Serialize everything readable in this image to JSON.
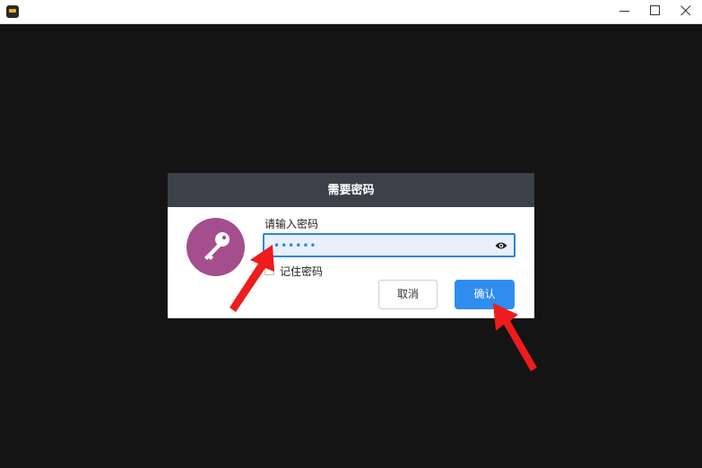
{
  "window": {
    "title": "",
    "icon": "app-icon",
    "controls": [
      "minimize-icon",
      "maximize-icon",
      "close-icon"
    ]
  },
  "dialog": {
    "title": "需要密码",
    "icon": "key-icon",
    "password_label": "请输入密码",
    "password_value": "••••••",
    "remember_label": "记住密码",
    "remember_checked": false,
    "cancel_label": "取消",
    "confirm_label": "确认"
  },
  "colors": {
    "background": "#141414",
    "dialog_header": "#3c4048",
    "accent": "#2f8df0",
    "key_circle": "#a44e8e",
    "annotation_arrow": "#ee1c1c"
  }
}
